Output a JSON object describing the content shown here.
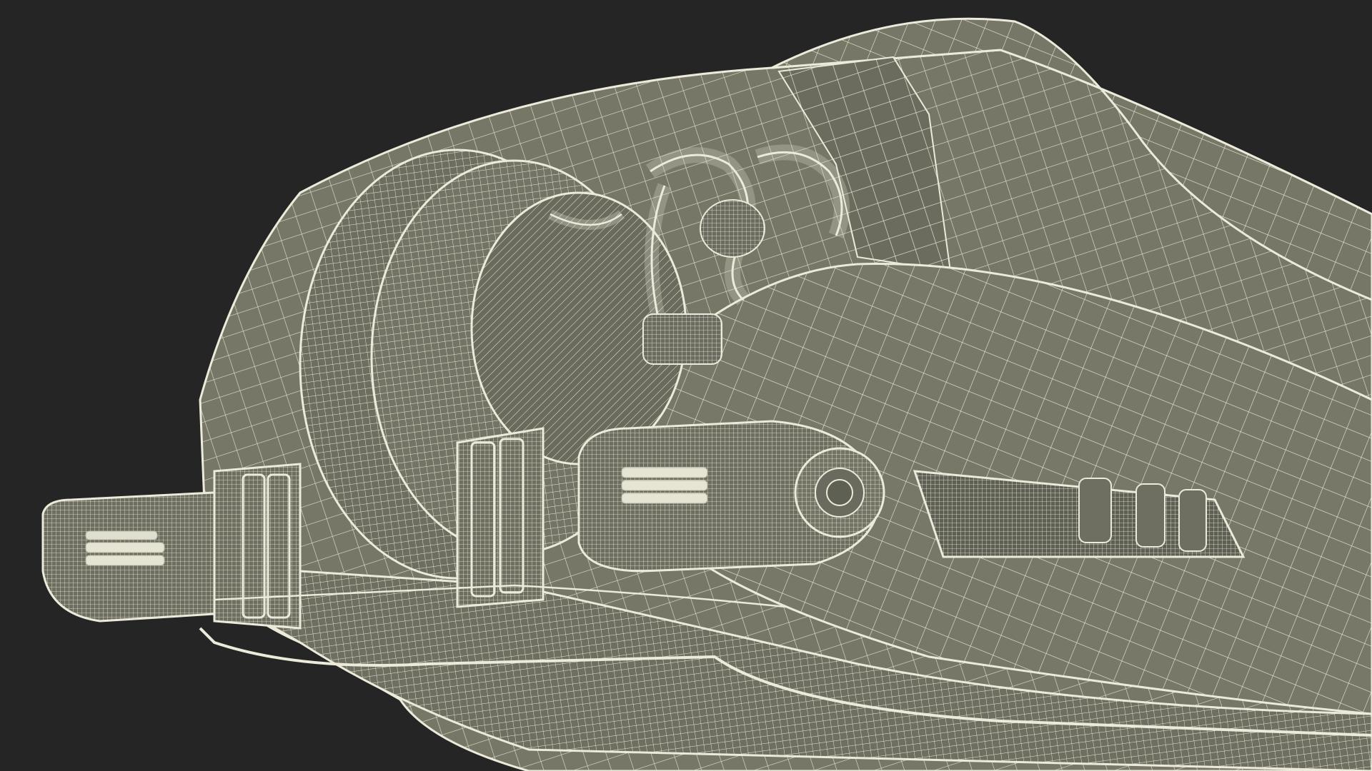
{
  "scene": {
    "background_color": "#252525",
    "surface_color": "#767767",
    "surface_shadow_color": "#5f5f52",
    "wire_color": "#eceada",
    "subject": "wireframe-hover-vehicle-front"
  }
}
